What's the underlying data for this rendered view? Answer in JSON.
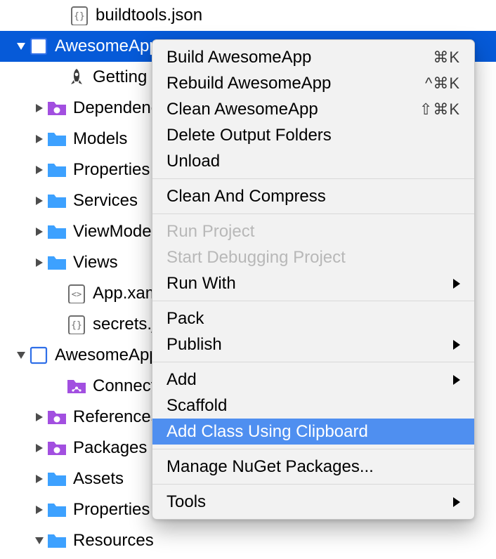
{
  "tree": {
    "items": [
      {
        "indent": "pad0",
        "arrow": "",
        "icon": "json",
        "label": "buildtools.json"
      },
      {
        "indent": "pad1",
        "arrow": "down",
        "icon": "proj",
        "label": "AwesomeApp",
        "selected": true
      },
      {
        "indent": "pad2",
        "arrow": "",
        "icon": "rocket",
        "label": "Getting Started"
      },
      {
        "indent": "pad2b",
        "arrow": "right",
        "icon": "pkg",
        "label": "Dependencies"
      },
      {
        "indent": "pad2b",
        "arrow": "right",
        "icon": "folder",
        "label": "Models"
      },
      {
        "indent": "pad2b",
        "arrow": "right",
        "icon": "folder",
        "label": "Properties"
      },
      {
        "indent": "pad2b",
        "arrow": "right",
        "icon": "folder",
        "label": "Services"
      },
      {
        "indent": "pad2b",
        "arrow": "right",
        "icon": "folder",
        "label": "ViewModels"
      },
      {
        "indent": "pad2b",
        "arrow": "right",
        "icon": "folder",
        "label": "Views"
      },
      {
        "indent": "pad2",
        "arrow": "",
        "icon": "xaml",
        "label": "App.xaml"
      },
      {
        "indent": "pad2",
        "arrow": "",
        "icon": "json",
        "label": "secrets.json"
      },
      {
        "indent": "pad1",
        "arrow": "down",
        "icon": "proj",
        "label": "AwesomeApp.Android",
        "selColor": "#000"
      },
      {
        "indent": "pad2",
        "arrow": "",
        "icon": "conn",
        "label": "Connected Services"
      },
      {
        "indent": "pad2b",
        "arrow": "right",
        "icon": "pkg",
        "label": "References"
      },
      {
        "indent": "pad2b",
        "arrow": "right",
        "icon": "pkg",
        "label": "Packages"
      },
      {
        "indent": "pad2b",
        "arrow": "right",
        "icon": "folder",
        "label": "Assets"
      },
      {
        "indent": "pad2b",
        "arrow": "right",
        "icon": "folder",
        "label": "Properties"
      },
      {
        "indent": "pad3",
        "arrow": "down",
        "icon": "folder",
        "label": "Resources"
      }
    ]
  },
  "menu": {
    "groups": [
      [
        {
          "label": "Build AwesomeApp",
          "shortcut": "⌘K"
        },
        {
          "label": "Rebuild AwesomeApp",
          "shortcut": "^⌘K"
        },
        {
          "label": "Clean AwesomeApp",
          "shortcut": "⇧⌘K"
        },
        {
          "label": "Delete Output Folders"
        },
        {
          "label": "Unload"
        }
      ],
      [
        {
          "label": "Clean And Compress"
        }
      ],
      [
        {
          "label": "Run Project",
          "disabled": true
        },
        {
          "label": "Start Debugging Project",
          "disabled": true
        },
        {
          "label": "Run With",
          "submenu": true
        }
      ],
      [
        {
          "label": "Pack"
        },
        {
          "label": "Publish",
          "submenu": true
        }
      ],
      [
        {
          "label": "Add",
          "submenu": true
        },
        {
          "label": "Scaffold"
        },
        {
          "label": "Add Class Using Clipboard",
          "highlight": true
        }
      ],
      [
        {
          "label": "Manage NuGet Packages..."
        }
      ],
      [
        {
          "label": "Tools",
          "submenu": true
        }
      ]
    ]
  }
}
